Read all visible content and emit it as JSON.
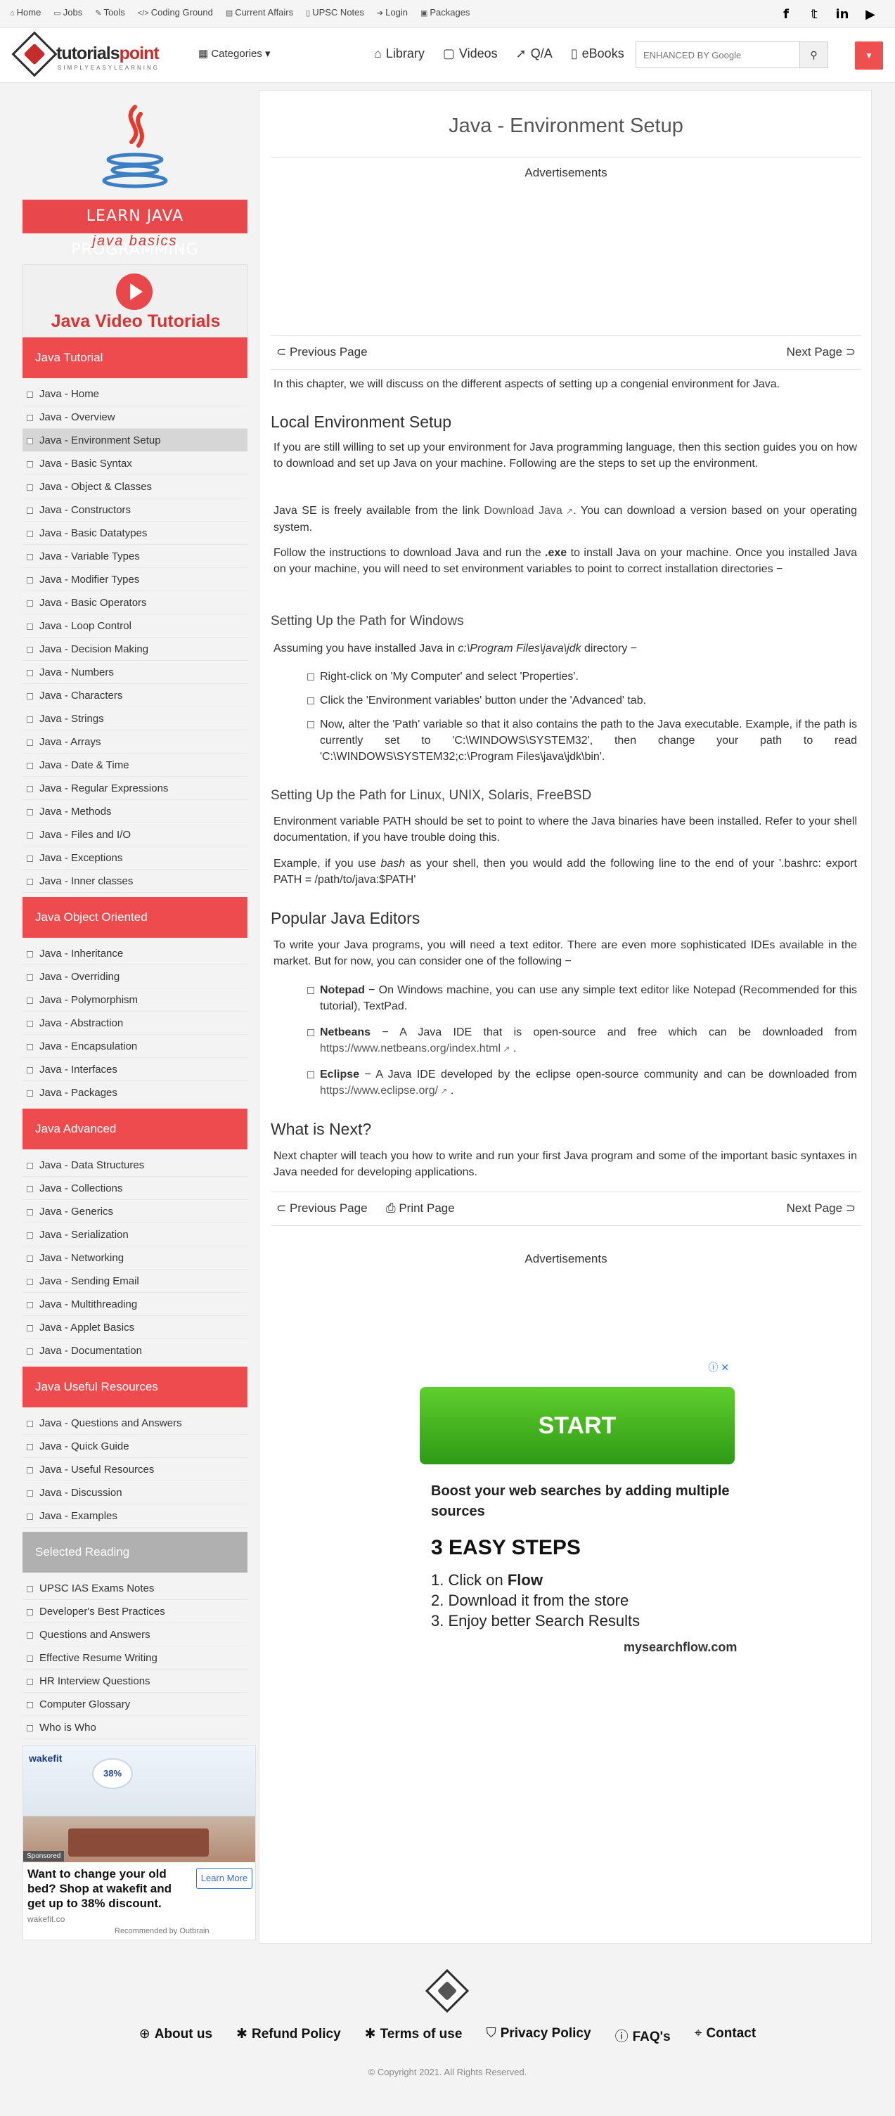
{
  "topbar": {
    "links": [
      {
        "icon": "home-icon",
        "label": "Home"
      },
      {
        "icon": "jobs-icon",
        "label": "Jobs"
      },
      {
        "icon": "tools-icon",
        "label": "Tools"
      },
      {
        "icon": "code-icon",
        "label": "Coding Ground"
      },
      {
        "icon": "current-affairs-icon",
        "label": "Current Affairs"
      },
      {
        "icon": "notes-icon",
        "label": "UPSC Notes"
      },
      {
        "icon": "login-icon",
        "label": "Login"
      },
      {
        "icon": "packages-icon",
        "label": "Packages"
      }
    ],
    "social": [
      "facebook-icon",
      "twitter-icon",
      "linkedin-icon",
      "youtube-icon"
    ]
  },
  "header": {
    "logo_brand": "tutorials",
    "logo_brand_accent": "point",
    "logo_tag": "SIMPLYEASYLEARNING",
    "categories": "Categories",
    "nav": [
      {
        "icon": "library-icon",
        "label": "Library"
      },
      {
        "icon": "videos-icon",
        "label": "Videos"
      },
      {
        "icon": "qa-icon",
        "label": "Q/A"
      },
      {
        "icon": "ebooks-icon",
        "label": "eBooks"
      }
    ],
    "search_placeholder": "ENHANCED BY Google"
  },
  "sidebar": {
    "learn_banner": "LEARN JAVA PROGRAMMING",
    "learn_sub": "java basics",
    "video_banner": "Java Video Tutorials",
    "sections": [
      {
        "title": "Java Tutorial",
        "items": [
          "Java - Home",
          "Java - Overview",
          "Java - Environment Setup",
          "Java - Basic Syntax",
          "Java - Object & Classes",
          "Java - Constructors",
          "Java - Basic Datatypes",
          "Java - Variable Types",
          "Java - Modifier Types",
          "Java - Basic Operators",
          "Java - Loop Control",
          "Java - Decision Making",
          "Java - Numbers",
          "Java - Characters",
          "Java - Strings",
          "Java - Arrays",
          "Java - Date & Time",
          "Java - Regular Expressions",
          "Java - Methods",
          "Java - Files and I/O",
          "Java - Exceptions",
          "Java - Inner classes"
        ]
      },
      {
        "title": "Java Object Oriented",
        "items": [
          "Java - Inheritance",
          "Java - Overriding",
          "Java - Polymorphism",
          "Java - Abstraction",
          "Java - Encapsulation",
          "Java - Interfaces",
          "Java - Packages"
        ]
      },
      {
        "title": "Java Advanced",
        "items": [
          "Java - Data Structures",
          "Java - Collections",
          "Java - Generics",
          "Java - Serialization",
          "Java - Networking",
          "Java - Sending Email",
          "Java - Multithreading",
          "Java - Applet Basics",
          "Java - Documentation"
        ]
      },
      {
        "title": "Java Useful Resources",
        "items": [
          "Java - Questions and Answers",
          "Java - Quick Guide",
          "Java - Useful Resources",
          "Java - Discussion",
          "Java - Examples"
        ]
      },
      {
        "title": "Selected Reading",
        "items": [
          "UPSC IAS Exams Notes",
          "Developer's Best Practices",
          "Questions and Answers",
          "Effective Resume Writing",
          "HR Interview Questions",
          "Computer Glossary",
          "Who is Who"
        ]
      }
    ],
    "active_item": "Java - Environment Setup",
    "ad": {
      "brand": "wakefit",
      "badge": "38%",
      "sponsored": "Sponsored",
      "text": "Want to change your old bed? Shop at wakefit and get up to 38% discount.",
      "button": "Learn More",
      "site": "wakefit.co",
      "outbrain": "Recommended by Outbrain"
    }
  },
  "main": {
    "title": "Java - Environment Setup",
    "ads_label": "Advertisements",
    "prev": "Previous Page",
    "next": "Next Page",
    "print": "Print Page",
    "intro": "In this chapter, we will discuss on the different aspects of setting up a congenial environment for Java.",
    "h_local": "Local Environment Setup",
    "p_local1": "If you are still willing to set up your environment for Java programming language, then this section guides you on how to download and set up Java on your machine. Following are the steps to set up the environment.",
    "p_local2_a": "Java SE is freely available from the link ",
    "p_local2_link": "Download Java",
    "p_local2_b": ". You can download a version based on your operating system.",
    "p_local3_a": "Follow the instructions to download Java and run the ",
    "p_local3_bold": ".exe",
    "p_local3_b": " to install Java on your machine. Once you installed Java on your machine, you will need to set environment variables to point to correct installation directories −",
    "h_windows": "Setting Up the Path for Windows",
    "p_windows_a": "Assuming you have installed Java in ",
    "p_windows_code": "c:\\Program Files\\java\\jdk",
    "p_windows_b": " directory −",
    "win_steps": [
      "Right-click on 'My Computer' and select 'Properties'.",
      "Click the 'Environment variables' button under the 'Advanced' tab.",
      "Now, alter the 'Path' variable so that it also contains the path to the Java executable. Example, if the path is currently set to 'C:\\WINDOWS\\SYSTEM32', then change your path to read 'C:\\WINDOWS\\SYSTEM32;c:\\Program Files\\java\\jdk\\bin'."
    ],
    "h_linux": "Setting Up the Path for Linux, UNIX, Solaris, FreeBSD",
    "p_linux1": "Environment variable PATH should be set to point to where the Java binaries have been installed. Refer to your shell documentation, if you have trouble doing this.",
    "p_linux2_a": "Example, if you use ",
    "p_linux2_code": "bash",
    "p_linux2_b": " as your shell, then you would add the following line to the end of your '.bashrc: export PATH = /path/to/java:$PATH'",
    "h_editors": "Popular Java Editors",
    "p_editors": "To write your Java programs, you will need a text editor. There are even more sophisticated IDEs available in the market. But for now, you can consider one of the following −",
    "editors": [
      {
        "name": "Notepad",
        "desc": " − On Windows machine, you can use any simple text editor like Notepad (Recommended for this tutorial), TextPad.",
        "link": ""
      },
      {
        "name": "Netbeans",
        "desc": " − A Java IDE that is open-source and free which can be downloaded from ",
        "link": "https://www.netbeans.org/index.html"
      },
      {
        "name": "Eclipse",
        "desc": " − A Java IDE developed by the eclipse open-source community and can be downloaded from ",
        "link": "https://www.eclipse.org/"
      }
    ],
    "h_next": "What is Next?",
    "p_next": "Next chapter will teach you how to write and run your first Java program and some of the important basic syntaxes in Java needed for developing applications."
  },
  "bottom_ad": {
    "start": "START",
    "boost": "Boost your web searches by adding multiple sources",
    "easy": "3 EASY STEPS",
    "steps_a": [
      "1. Click on ",
      "2. Download it from the store",
      "3. Enjoy better Search Results"
    ],
    "flow": "Flow",
    "brand": "mysearchflow.com"
  },
  "footer": {
    "links": [
      {
        "icon": "globe-icon",
        "label": "About us"
      },
      {
        "icon": "asterisk-icon",
        "label": "Refund Policy"
      },
      {
        "icon": "asterisk-icon",
        "label": "Terms of use"
      },
      {
        "icon": "shield-icon",
        "label": "Privacy Policy"
      },
      {
        "icon": "question-icon",
        "label": "FAQ's"
      },
      {
        "icon": "location-icon",
        "label": "Contact"
      }
    ],
    "copyright": "© Copyright 2021. All Rights Reserved."
  }
}
